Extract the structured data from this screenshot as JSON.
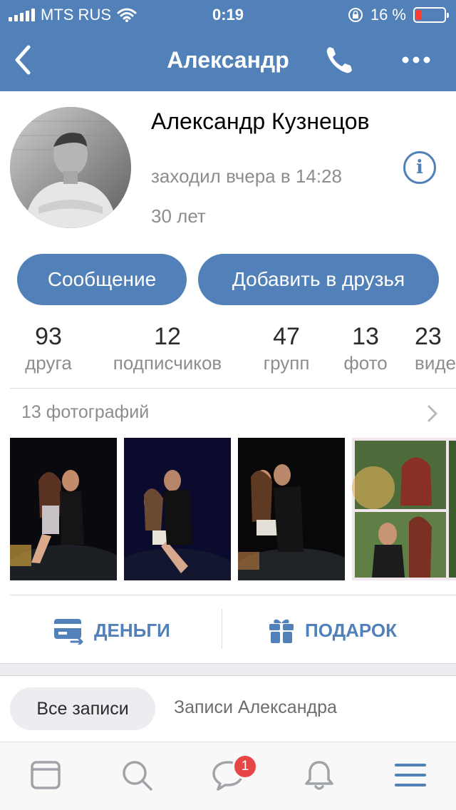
{
  "status_bar": {
    "carrier": "MTS RUS",
    "time": "0:19",
    "battery_percent": "16 %",
    "battery_level": 0.16
  },
  "nav": {
    "title": "Александр",
    "back_icon": "chevron-left-icon",
    "call_icon": "phone-icon",
    "more_icon": "more-dots-icon"
  },
  "profile": {
    "name": "Александр Кузнецов",
    "last_seen": "заходил вчера в 14:28",
    "age": "30 лет",
    "info_icon": "info-icon"
  },
  "buttons": {
    "message": "Сообщение",
    "add_friend": "Добавить в друзья"
  },
  "counters": [
    {
      "value": "93",
      "label": "друга"
    },
    {
      "value": "12",
      "label": "подписчиков"
    },
    {
      "value": "47",
      "label": "групп"
    },
    {
      "value": "13",
      "label": "фото"
    },
    {
      "value": "23",
      "label": "видео"
    }
  ],
  "photos": {
    "header": "13 фотографий",
    "count_visible": 4
  },
  "actions": {
    "money": "ДЕНЬГИ",
    "gift": "ПОДАРОК"
  },
  "wall_tabs": {
    "all": "Все записи",
    "own": "Записи Александра"
  },
  "tabbar": {
    "items": [
      "news-icon",
      "search-icon",
      "messages-icon",
      "notifications-icon",
      "menu-icon"
    ],
    "messages_badge": "1"
  },
  "colors": {
    "accent": "#5181b8",
    "badge": "#e64646",
    "secondary_text": "#8d8d8d"
  }
}
